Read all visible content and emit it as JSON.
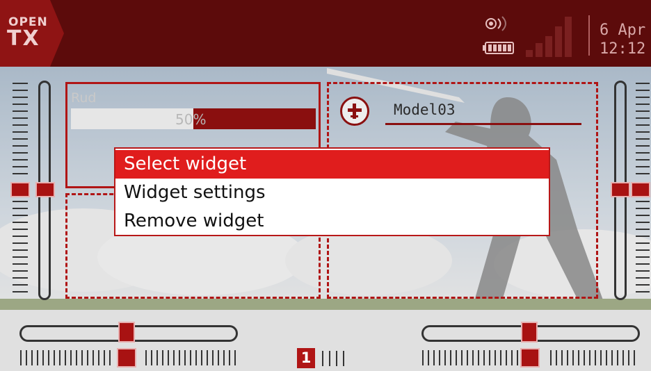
{
  "header": {
    "logo_top": "OPEN",
    "logo_bottom": "TX",
    "date_day": "6 Apr",
    "time": "12:12",
    "icons": [
      "rf-signal-icon",
      "battery-icon",
      "signal-bars-icon"
    ]
  },
  "widgets": {
    "rud": {
      "label": "Rud",
      "percent_text": "50%",
      "value": 0.5
    },
    "model": {
      "name": "Model03",
      "icon": "airplane-icon"
    }
  },
  "menu": {
    "items": [
      {
        "label": "Select widget",
        "selected": true
      },
      {
        "label": "Widget settings",
        "selected": false
      },
      {
        "label": "Remove widget",
        "selected": false
      }
    ]
  },
  "flight_mode": {
    "number": "1"
  },
  "colors": {
    "header_bg": "#5c0b0b",
    "accent": "#b01515",
    "menu_selected": "#e01d1d"
  }
}
